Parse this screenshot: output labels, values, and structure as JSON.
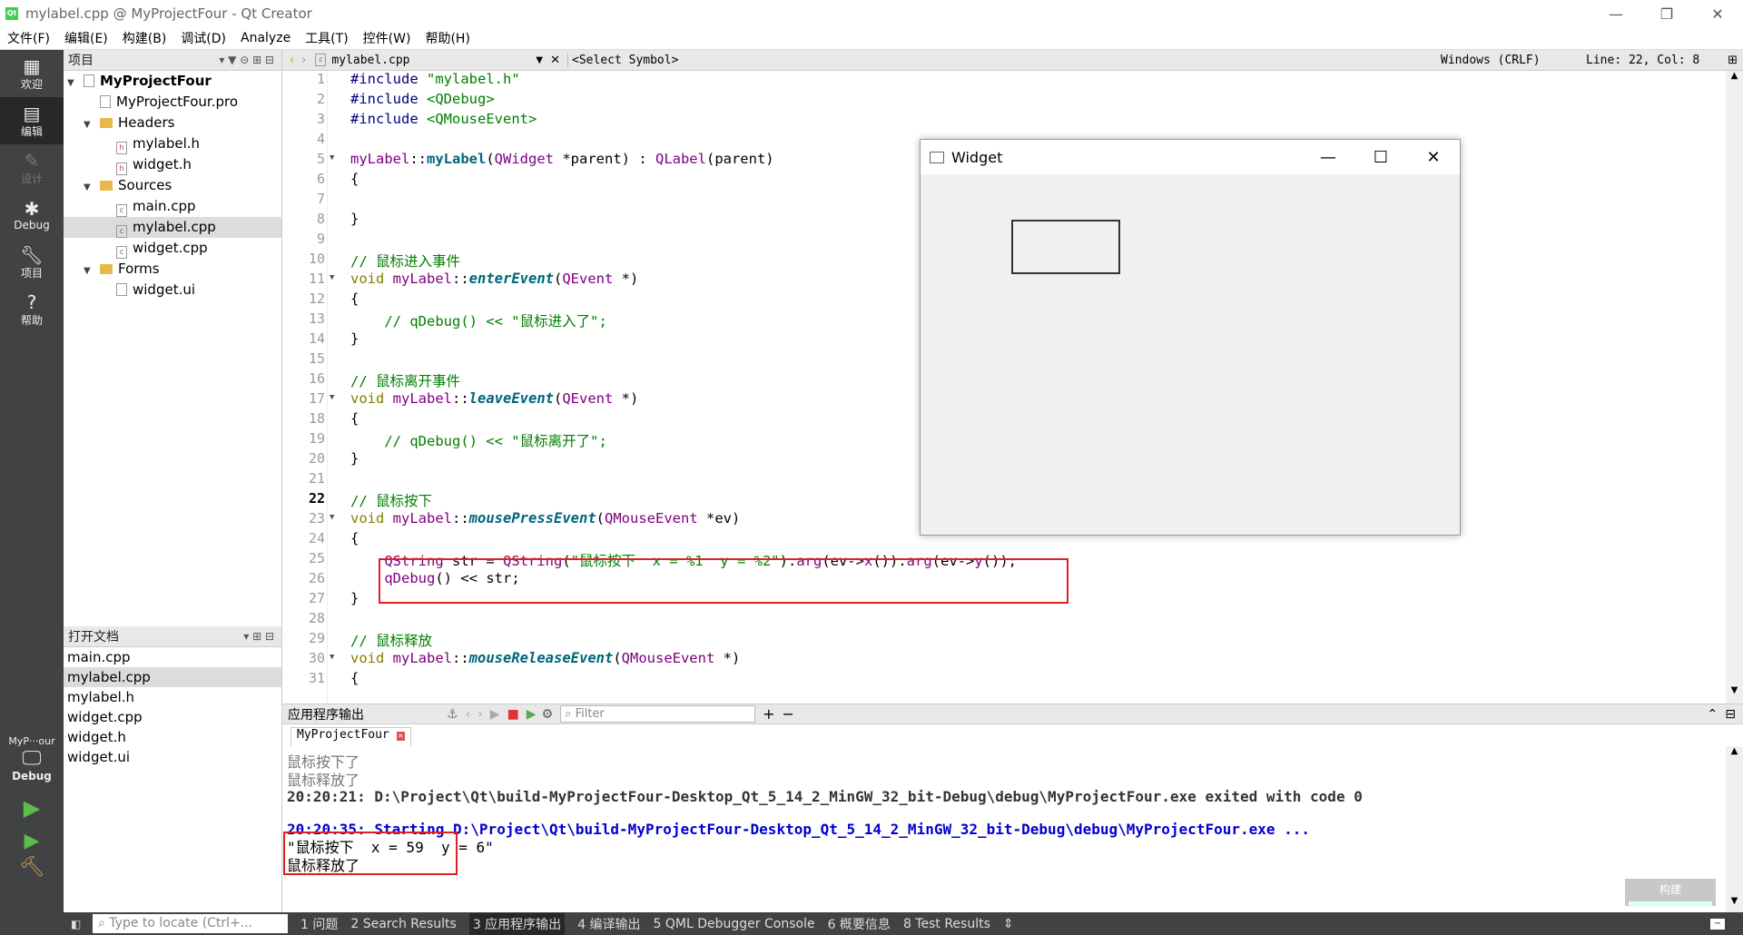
{
  "window": {
    "title": "mylabel.cpp @ MyProjectFour - Qt Creator",
    "controls": [
      "—",
      "❐",
      "✕"
    ]
  },
  "menu": [
    "文件(F)",
    "编辑(E)",
    "构建(B)",
    "调试(D)",
    "Analyze",
    "工具(T)",
    "控件(W)",
    "帮助(H)"
  ],
  "modes": [
    {
      "label": "欢迎",
      "icon": "grid-icon"
    },
    {
      "label": "编辑",
      "icon": "edit-icon",
      "active": true
    },
    {
      "label": "设计",
      "icon": "pencil-icon",
      "dim": true
    },
    {
      "label": "Debug",
      "icon": "bug-icon"
    },
    {
      "label": "项目",
      "icon": "wrench-icon"
    },
    {
      "label": "帮助",
      "icon": "help-icon"
    }
  ],
  "kit": {
    "name": "MyP···our",
    "mode": "Debug"
  },
  "project_pane": {
    "title": "项目",
    "tree": [
      {
        "label": "MyProjectFour",
        "level": 0,
        "type": "project",
        "arrow": "▼"
      },
      {
        "label": "MyProjectFour.pro",
        "level": 1,
        "type": "file",
        "arrow": ""
      },
      {
        "label": "Headers",
        "level": 1,
        "type": "folder",
        "arrow": "▼"
      },
      {
        "label": "mylabel.h",
        "level": 2,
        "type": "hfile",
        "arrow": ""
      },
      {
        "label": "widget.h",
        "level": 2,
        "type": "hfile",
        "arrow": ""
      },
      {
        "label": "Sources",
        "level": 1,
        "type": "folder",
        "arrow": "▼"
      },
      {
        "label": "main.cpp",
        "level": 2,
        "type": "cfile",
        "arrow": ""
      },
      {
        "label": "mylabel.cpp",
        "level": 2,
        "type": "cfile",
        "arrow": "",
        "selected": true
      },
      {
        "label": "widget.cpp",
        "level": 2,
        "type": "cfile",
        "arrow": ""
      },
      {
        "label": "Forms",
        "level": 1,
        "type": "folder",
        "arrow": "▼"
      },
      {
        "label": "widget.ui",
        "level": 2,
        "type": "uifile",
        "arrow": ""
      }
    ]
  },
  "open_docs": {
    "title": "打开文档",
    "items": [
      "main.cpp",
      "mylabel.cpp",
      "mylabel.h",
      "widget.cpp",
      "widget.h",
      "widget.ui"
    ],
    "selected": 1
  },
  "editor_bar": {
    "file": "mylabel.cpp",
    "symbol": "<Select Symbol>",
    "encoding": "Windows (CRLF)",
    "position": "Line: 22, Col: 8"
  },
  "code": {
    "current_line": 22,
    "lines": [
      "1",
      "2",
      "3",
      "4",
      "5",
      "6",
      "7",
      "8",
      "9",
      "10",
      "11",
      "12",
      "13",
      "14",
      "15",
      "16",
      "17",
      "18",
      "19",
      "20",
      "21",
      "22",
      "23",
      "24",
      "25",
      "26",
      "27",
      "28",
      "29",
      "30",
      "31"
    ]
  },
  "widget_window": {
    "title": "Widget",
    "controls": [
      "—",
      "☐",
      "✕"
    ]
  },
  "output": {
    "header": "应用程序输出",
    "filter_placeholder": "Filter",
    "tab": "MyProjectFour",
    "lines": [
      "鼠标按下了",
      "鼠标释放了",
      "20:20:21: D:\\Project\\Qt\\build-MyProjectFour-Desktop_Qt_5_14_2_MinGW_32_bit-Debug\\debug\\MyProjectFour.exe exited with code 0",
      "20:20:35: Starting D:\\Project\\Qt\\build-MyProjectFour-Desktop_Qt_5_14_2_MinGW_32_bit-Debug\\debug\\MyProjectFour.exe ...",
      "\"鼠标按下  x = 59  y = 6\"",
      "鼠标释放了"
    ],
    "build_label": "构建"
  },
  "status": {
    "locate_placeholder": "Type to locate (Ctrl+...",
    "tabs": [
      "1 问题",
      "2 Search Results",
      "3 应用程序输出",
      "4 编译输出",
      "5 QML Debugger Console",
      "6 概要信息",
      "8 Test Results"
    ]
  }
}
